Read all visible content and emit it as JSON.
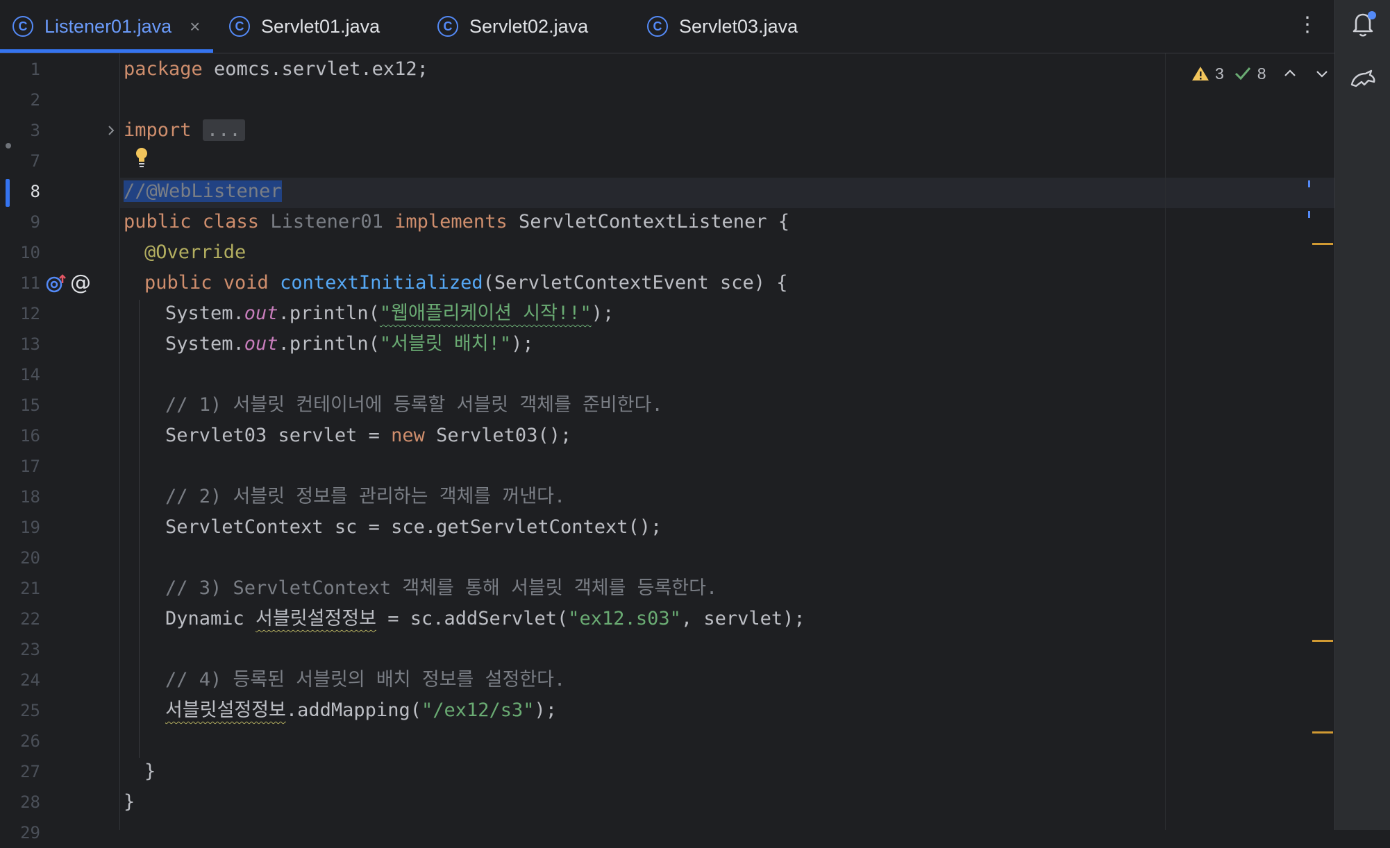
{
  "tabs": [
    {
      "label": "Listener01.java",
      "active": true,
      "closable": true,
      "icon": "class-icon"
    },
    {
      "label": "Servlet01.java",
      "active": false,
      "icon": "class-icon"
    },
    {
      "label": "Servlet02.java",
      "active": false,
      "icon": "class-icon"
    },
    {
      "label": "Servlet03.java",
      "active": false,
      "icon": "class-icon"
    }
  ],
  "tab_icon_glyph": "C",
  "close_glyph": "×",
  "kebab_glyph": "⋮",
  "inspections": {
    "warnings": "3",
    "ok": "8"
  },
  "line_numbers": [
    "1",
    "2",
    "3",
    "7",
    "8",
    "9",
    "10",
    "11",
    "12",
    "13",
    "14",
    "15",
    "16",
    "17",
    "18",
    "19",
    "20",
    "21",
    "22",
    "23",
    "24",
    "25",
    "26",
    "27",
    "28",
    "29"
  ],
  "current_line": "8",
  "code": {
    "l1_kw": "package",
    "l1_rest": " eomcs.servlet.ex12;",
    "l3_kw": "import",
    "l3_fold": "...",
    "l8": "//@WebListener",
    "l9_kw1": "public class",
    "l9_name": " Listener01",
    "l9_kw2": " implements",
    "l9_rest": " ServletContextListener {",
    "l10": "@Override",
    "l11_kw": "public void",
    "l11_fn": " contextInitialized",
    "l11_rest": "(ServletContextEvent sce) {",
    "l12_a": "System.",
    "l12_out": "out",
    "l12_b": ".println(",
    "l12_str": "\"웹애플리케이션 시작!!\"",
    "l12_c": ");",
    "l13_a": "System.",
    "l13_out": "out",
    "l13_b": ".println(",
    "l13_str": "\"서블릿 배치!\"",
    "l13_c": ");",
    "l15": "// 1) 서블릿 컨테이너에 등록할 서블릿 객체를 준비한다.",
    "l16_a": "Servlet03 servlet = ",
    "l16_kw": "new",
    "l16_b": " Servlet03();",
    "l18": "// 2) 서블릿 정보를 관리하는 객체를 꺼낸다.",
    "l19": "ServletContext sc = sce.getServletContext();",
    "l21": "// 3) ServletContext 객체를 통해 서블릿 객체를 등록한다.",
    "l22_a": "Dynamic ",
    "l22_var": "서블릿설정정보",
    "l22_b": " = sc.addServlet(",
    "l22_str": "\"ex12.s03\"",
    "l22_c": ", servlet);",
    "l24": "// 4) 등록된 서블릿의 배치 정보를 설정한다.",
    "l25_var": "서블릿설정정보",
    "l25_a": ".addMapping(",
    "l25_str": "\"/ex12/s3\"",
    "l25_b": ");",
    "l27": "}",
    "l28": "}"
  },
  "colors": {
    "keyword": "#cf8e6d",
    "string": "#6aab73",
    "comment": "#7a7e85",
    "function": "#56a8f5",
    "annotation": "#b3ae60",
    "static_field": "#c77dbb",
    "accent": "#3574f0",
    "warning": "#d19a33"
  }
}
